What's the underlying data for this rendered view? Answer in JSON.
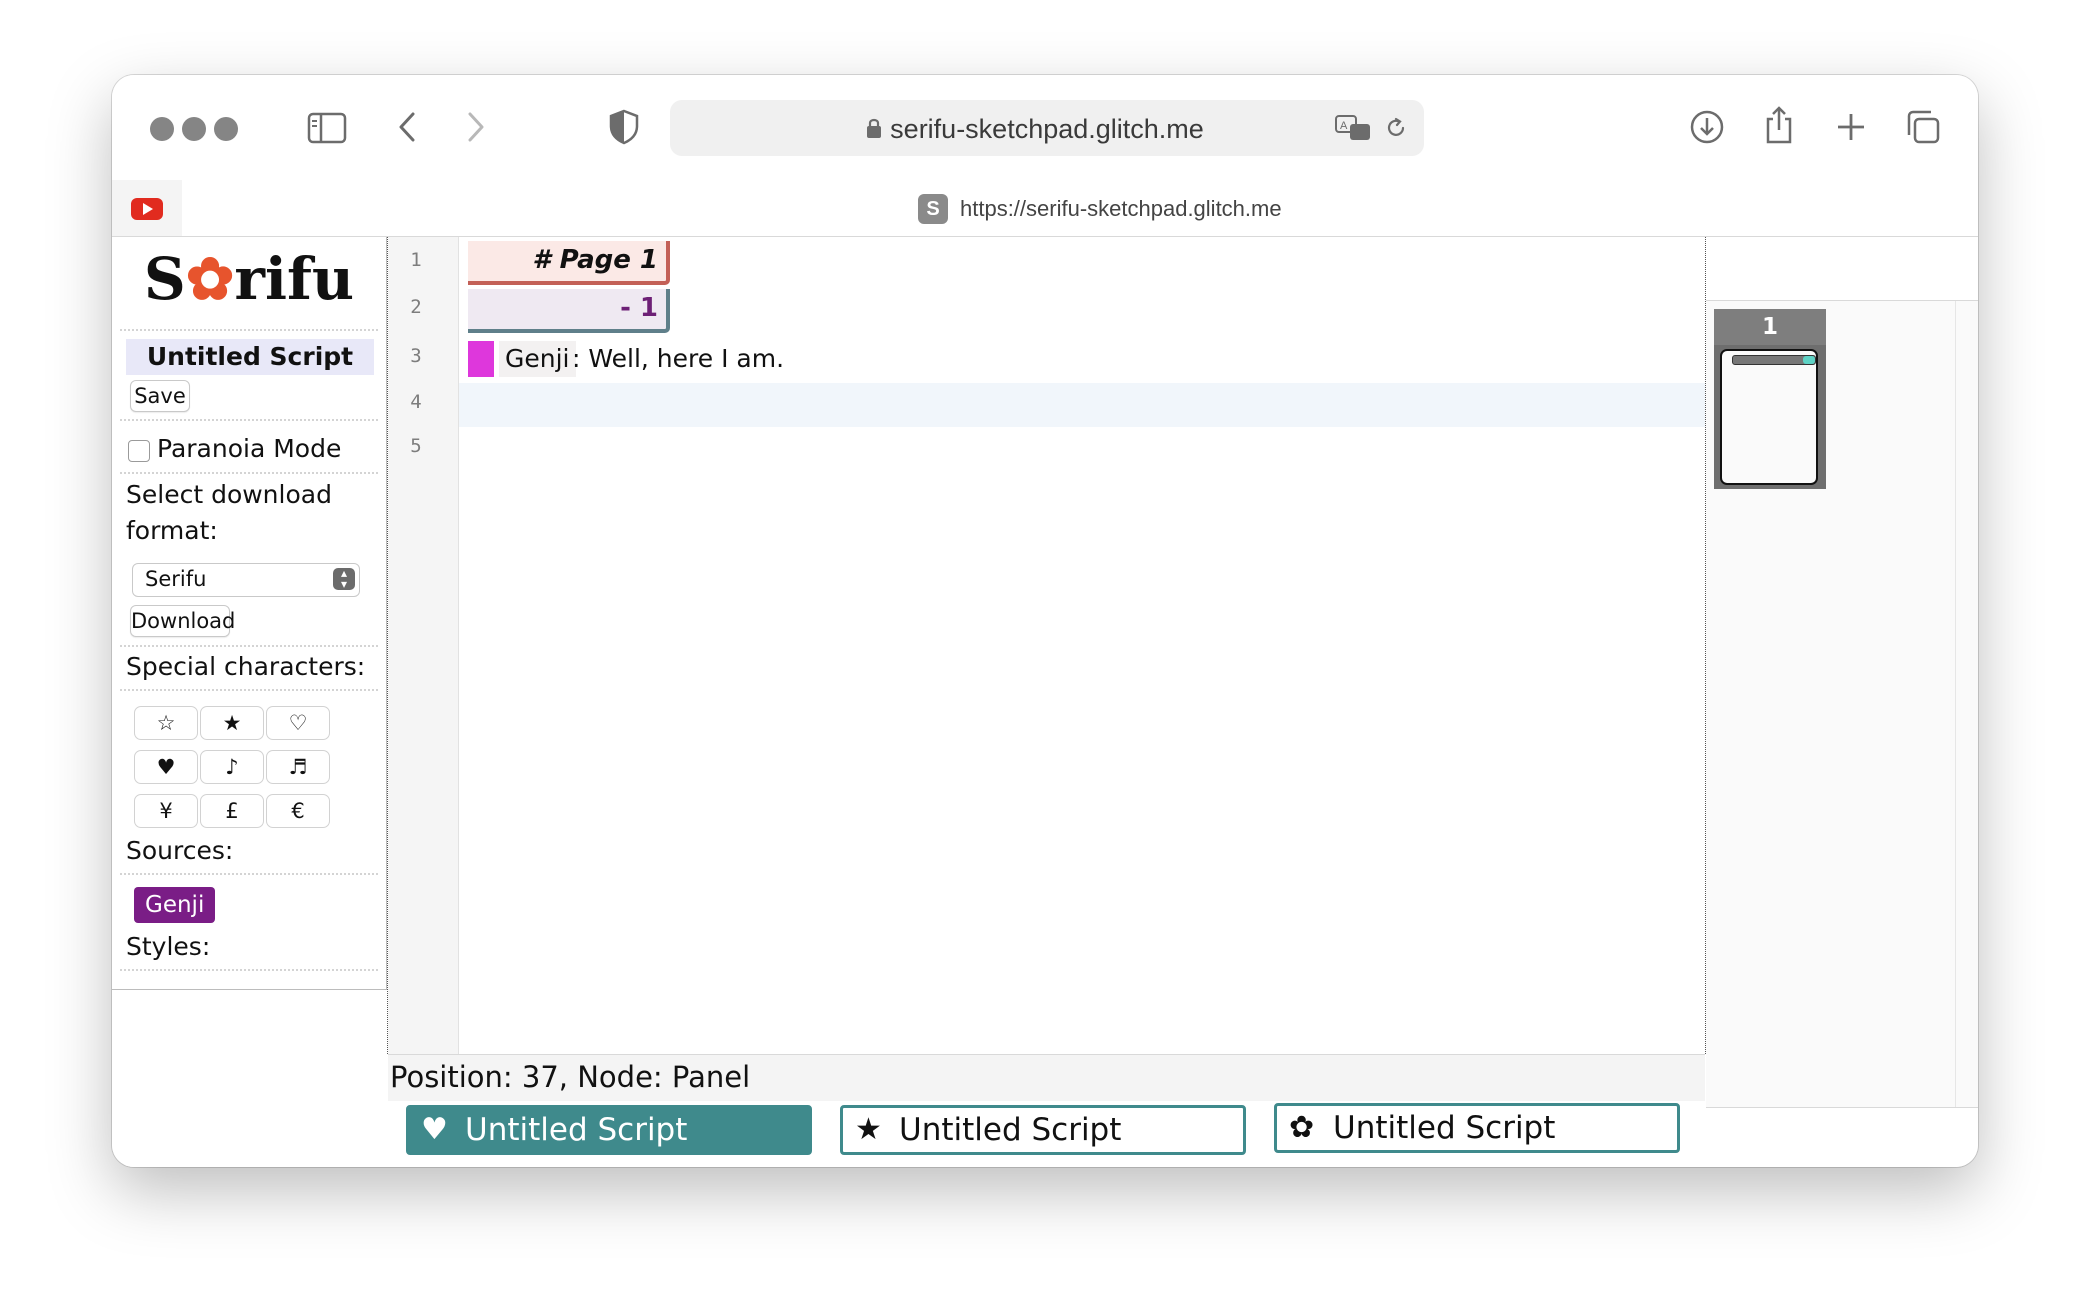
{
  "browser": {
    "url": "serifu-sketchpad.glitch.me",
    "tab_url": "https://serifu-sketchpad.glitch.me",
    "favicon_letter": "S"
  },
  "app": {
    "logo": "Serifu",
    "script_title": "Untitled Script",
    "save_label": "Save",
    "paranoia_label": "Paranoia Mode",
    "paranoia_checked": false,
    "download_format_label": "Select download format:",
    "download_format_value": "Serifu",
    "download_label": "Download",
    "special_label": "Special characters:",
    "special_chars": [
      "☆",
      "★",
      "♡",
      "♥",
      "♪",
      "♬",
      "¥",
      "£",
      "€"
    ],
    "sources_label": "Sources:",
    "sources": [
      "Genji"
    ],
    "source_color": "#7a1d86",
    "styles_label": "Styles:"
  },
  "editor": {
    "line_numbers": [
      "1",
      "2",
      "3",
      "4",
      "5"
    ],
    "page_heading": "# Page 1",
    "panel_heading": "- 1",
    "speaker": "Genji",
    "speaker_color": "#de37dc",
    "dialogue": ": Well, here I am."
  },
  "status": "Position: 37, Node: Panel",
  "doc_tabs": [
    {
      "icon": "heart-icon",
      "glyph": "♥",
      "label": "Untitled Script",
      "active": true
    },
    {
      "icon": "star-icon",
      "glyph": "★",
      "label": "Untitled Script",
      "active": false
    },
    {
      "icon": "flower-icon",
      "glyph": "✿",
      "label": "Untitled Script",
      "active": false
    }
  ],
  "accent_color": "#3f8a8c",
  "preview": {
    "page_number": "1"
  }
}
